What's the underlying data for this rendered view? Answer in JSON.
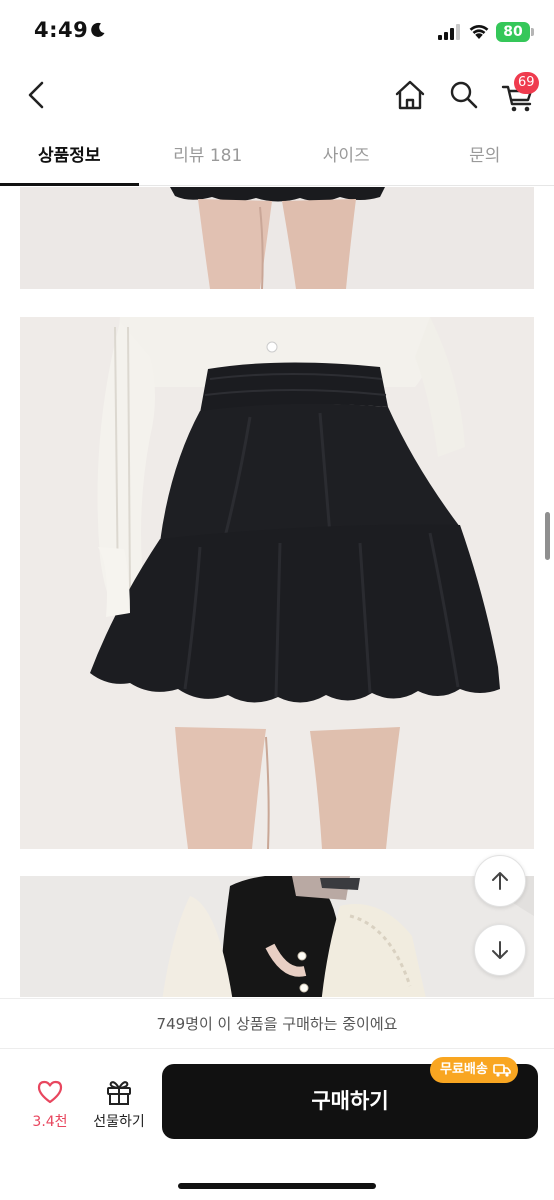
{
  "status_bar": {
    "time": "4:49",
    "battery": "80"
  },
  "nav": {
    "cart_count": "69"
  },
  "tabs": [
    {
      "label": "상품정보",
      "active": true
    },
    {
      "label": "리뷰 181",
      "active": false
    },
    {
      "label": "사이즈",
      "active": false
    },
    {
      "label": "문의",
      "active": false
    }
  ],
  "bottom": {
    "buyers_text": "749명이 이 상품을 구매하는 중이에요",
    "like_count": "3.4천",
    "gift_label": "선물하기",
    "buy_label": "구매하기",
    "free_shipping": "무료배송"
  },
  "colors": {
    "accent_pink": "#e8465e",
    "badge_red": "#ef3b4e",
    "free_ship_orange": "#f9a621",
    "buy_button": "#111111"
  }
}
